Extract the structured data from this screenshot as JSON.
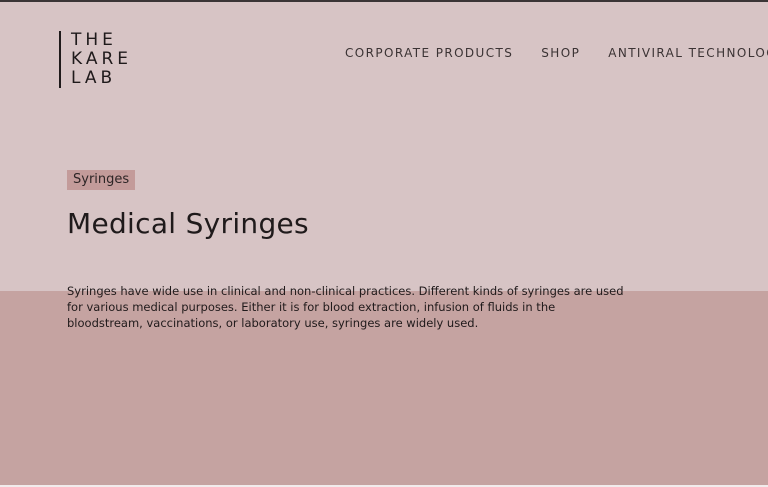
{
  "logo": {
    "line1": "THE",
    "line2": "KARE",
    "line3": "LAB"
  },
  "nav": {
    "items": [
      {
        "label": "CORPORATE PRODUCTS"
      },
      {
        "label": "SHOP"
      },
      {
        "label": "ANTIVIRAL TECHNOLOGY",
        "icon": "caret-down-icon"
      }
    ]
  },
  "page": {
    "tag": "Syringes",
    "title": "Medical Syringes",
    "description": "Syringes have wide use in clinical and non-clinical practices. Different kinds of syringes are used for various medical purposes. Either it is for blood extraction, infusion of fluids in the bloodstream, vaccinations, or laboratory use, syringes are widely used."
  },
  "colors": {
    "background_light": "#d7c4c5",
    "background_dark": "#c5a3a1",
    "tag_background": "#c39b9a",
    "text": "#1f1a1b"
  }
}
